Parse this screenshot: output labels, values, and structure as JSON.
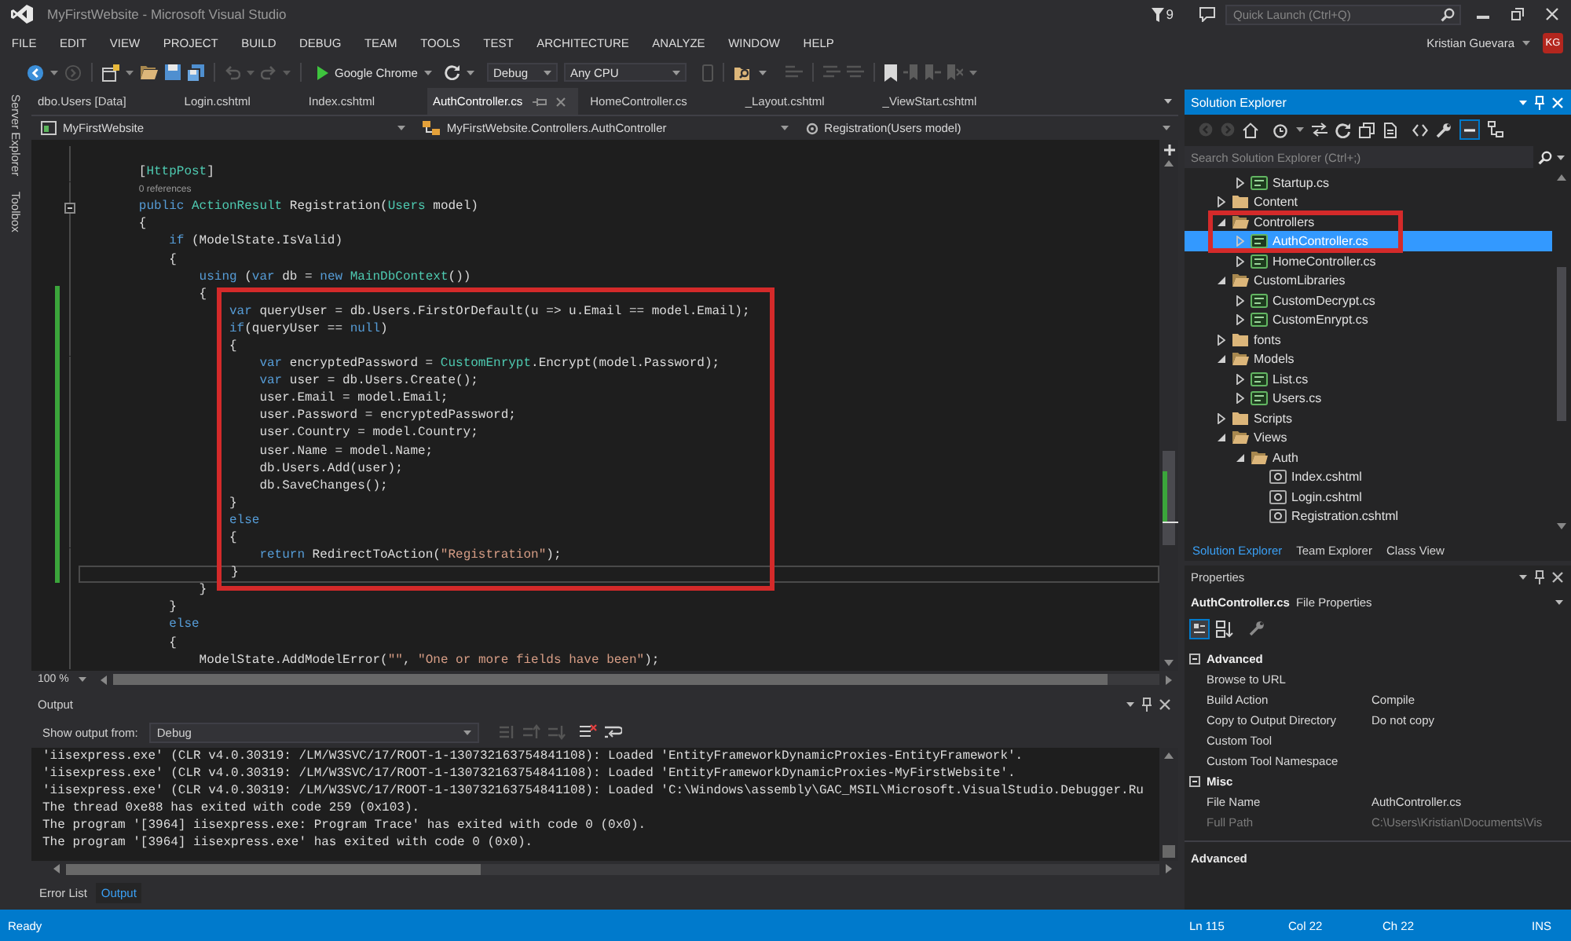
{
  "window": {
    "title": "MyFirstWebsite - Microsoft Visual Studio",
    "notification_count": "9",
    "quick_launch": {
      "placeholder": "Quick Launch (Ctrl+Q)"
    }
  },
  "menu": [
    "FILE",
    "EDIT",
    "VIEW",
    "PROJECT",
    "BUILD",
    "DEBUG",
    "TEAM",
    "TOOLS",
    "TEST",
    "ARCHITECTURE",
    "ANALYZE",
    "WINDOW",
    "HELP"
  ],
  "account": {
    "name": "Kristian Guevara",
    "initials": "KG"
  },
  "toolbar": {
    "run_target": "Google Chrome",
    "configuration": "Debug",
    "platform": "Any CPU"
  },
  "side_tabs": [
    "Server Explorer",
    "Toolbox"
  ],
  "editor": {
    "tabs": [
      {
        "label": "dbo.Users [Data]",
        "selected": false
      },
      {
        "label": "Login.cshtml",
        "selected": false
      },
      {
        "label": "Index.cshtml",
        "selected": false
      },
      {
        "label": "AuthController.cs",
        "selected": true
      },
      {
        "label": "HomeController.cs",
        "selected": false
      },
      {
        "label": "_Layout.cshtml",
        "selected": false
      },
      {
        "label": "_ViewStart.cshtml",
        "selected": false
      }
    ],
    "navigation": {
      "project": "MyFirstWebsite",
      "type": "MyFirstWebsite.Controllers.AuthController",
      "member": "Registration(Users model)"
    },
    "segments": [
      {
        "framed": false,
        "lines": [
          {
            "kind": "blank"
          },
          {
            "kind": "code",
            "changed": false,
            "current": false,
            "tokens": [
              {
                "text": "        [",
                "kind": "plain"
              },
              {
                "text": "HttpPost",
                "kind": "type"
              },
              {
                "text": "]",
                "kind": "plain"
              }
            ]
          },
          {
            "kind": "codelens",
            "changed": false,
            "current": false,
            "text": "        0 references"
          },
          {
            "kind": "declaration",
            "changed": false,
            "current": false,
            "tokens": [
              {
                "text": "        public ",
                "kind": "keyword"
              },
              {
                "text": "ActionResult",
                "kind": "type"
              },
              {
                "text": " Registration(",
                "kind": "plain"
              },
              {
                "text": "Users",
                "kind": "type"
              },
              {
                "text": " model)",
                "kind": "plain"
              }
            ]
          },
          {
            "kind": "code",
            "changed": false,
            "current": false,
            "tokens": [
              {
                "text": "        {",
                "kind": "plain"
              }
            ]
          },
          {
            "kind": "code",
            "changed": false,
            "current": false,
            "tokens": [
              {
                "text": "            if",
                "kind": "keyword"
              },
              {
                "text": " (ModelState.IsValid)",
                "kind": "plain"
              }
            ]
          },
          {
            "kind": "code",
            "changed": false,
            "current": false,
            "tokens": [
              {
                "text": "            {",
                "kind": "plain"
              }
            ]
          },
          {
            "kind": "code",
            "changed": false,
            "current": false,
            "tokens": [
              {
                "text": "                using",
                "kind": "keyword"
              },
              {
                "text": " (",
                "kind": "plain"
              },
              {
                "text": "var",
                "kind": "keyword"
              },
              {
                "text": " db = ",
                "kind": "plain"
              },
              {
                "text": "new ",
                "kind": "keyword"
              },
              {
                "text": "MainDbContext",
                "kind": "type"
              },
              {
                "text": "())",
                "kind": "plain"
              }
            ]
          },
          {
            "kind": "code",
            "changed": true,
            "current": false,
            "tokens": [
              {
                "text": "                {",
                "kind": "plain"
              }
            ]
          }
        ]
      },
      {
        "framed": true,
        "lines": [
          {
            "kind": "code",
            "changed": true,
            "current": false,
            "tokens": [
              {
                "text": "                    var",
                "kind": "keyword"
              },
              {
                "text": " queryUser = db.Users.FirstOrDefault(u => u.Email == model.Email);",
                "kind": "plain"
              }
            ]
          },
          {
            "kind": "code",
            "changed": true,
            "current": false,
            "tokens": [
              {
                "text": "                    if",
                "kind": "keyword"
              },
              {
                "text": "(queryUser == ",
                "kind": "plain"
              },
              {
                "text": "null",
                "kind": "keyword"
              },
              {
                "text": ")",
                "kind": "plain"
              }
            ]
          },
          {
            "kind": "code",
            "changed": true,
            "current": false,
            "tokens": [
              {
                "text": "                    {",
                "kind": "plain"
              }
            ]
          },
          {
            "kind": "code",
            "changed": true,
            "current": false,
            "tokens": [
              {
                "text": "                        var",
                "kind": "keyword"
              },
              {
                "text": " encryptedPassword = ",
                "kind": "plain"
              },
              {
                "text": "CustomEnrypt",
                "kind": "type"
              },
              {
                "text": ".Encrypt(model.Password);",
                "kind": "plain"
              }
            ]
          },
          {
            "kind": "code",
            "changed": true,
            "current": false,
            "tokens": [
              {
                "text": "                        var",
                "kind": "keyword"
              },
              {
                "text": " user = db.Users.Create();",
                "kind": "plain"
              }
            ]
          },
          {
            "kind": "code",
            "changed": true,
            "current": false,
            "tokens": [
              {
                "text": "                        user.Email = model.Email;",
                "kind": "plain"
              }
            ]
          },
          {
            "kind": "code",
            "changed": true,
            "current": false,
            "tokens": [
              {
                "text": "                        user.Password = encryptedPassword;",
                "kind": "plain"
              }
            ]
          },
          {
            "kind": "code",
            "changed": true,
            "current": false,
            "tokens": [
              {
                "text": "                        user.Country = model.Country;",
                "kind": "plain"
              }
            ]
          },
          {
            "kind": "code",
            "changed": true,
            "current": false,
            "tokens": [
              {
                "text": "                        user.Name = model.Name;",
                "kind": "plain"
              }
            ]
          },
          {
            "kind": "code",
            "changed": true,
            "current": false,
            "tokens": [
              {
                "text": "                        db.Users.Add(user);",
                "kind": "plain"
              }
            ]
          },
          {
            "kind": "code",
            "changed": true,
            "current": false,
            "tokens": [
              {
                "text": "                        db.SaveChanges();",
                "kind": "plain"
              }
            ]
          },
          {
            "kind": "code",
            "changed": true,
            "current": false,
            "tokens": [
              {
                "text": "                    }",
                "kind": "plain"
              }
            ]
          },
          {
            "kind": "code",
            "changed": true,
            "current": false,
            "tokens": [
              {
                "text": "                    else",
                "kind": "keyword"
              }
            ]
          },
          {
            "kind": "code",
            "changed": true,
            "current": false,
            "tokens": [
              {
                "text": "                    {",
                "kind": "plain"
              }
            ]
          },
          {
            "kind": "code",
            "changed": true,
            "current": false,
            "tokens": [
              {
                "text": "                        return",
                "kind": "keyword"
              },
              {
                "text": " RedirectToAction(",
                "kind": "plain"
              },
              {
                "text": "\"Registration\"",
                "kind": "string"
              },
              {
                "text": ");",
                "kind": "plain"
              }
            ]
          },
          {
            "kind": "code",
            "changed": true,
            "current": true,
            "tokens": [
              {
                "text": "                    }",
                "kind": "plain"
              }
            ]
          }
        ]
      },
      {
        "framed": false,
        "lines": [
          {
            "kind": "code",
            "changed": false,
            "current": false,
            "tokens": [
              {
                "text": "                }",
                "kind": "plain"
              }
            ]
          },
          {
            "kind": "code",
            "changed": false,
            "current": false,
            "tokens": [
              {
                "text": "            }",
                "kind": "plain"
              }
            ]
          },
          {
            "kind": "code",
            "changed": false,
            "current": false,
            "tokens": [
              {
                "text": "            else",
                "kind": "keyword"
              }
            ]
          },
          {
            "kind": "code",
            "changed": false,
            "current": false,
            "tokens": [
              {
                "text": "            {",
                "kind": "plain"
              }
            ]
          },
          {
            "kind": "code",
            "changed": false,
            "current": false,
            "tokens": [
              {
                "text": "                ModelState.AddModelError(",
                "kind": "plain"
              },
              {
                "text": "\"\"",
                "kind": "string"
              },
              {
                "text": ", ",
                "kind": "plain"
              },
              {
                "text": "\"One or more fields have been\"",
                "kind": "string"
              },
              {
                "text": ");",
                "kind": "plain"
              }
            ]
          }
        ]
      }
    ],
    "zoom": "100 %"
  },
  "output": {
    "title": "Output",
    "source_label": "Show output from:",
    "source": "Debug",
    "lines": [
      "'iisexpress.exe' (CLR v4.0.30319: /LM/W3SVC/17/ROOT-1-130732163754841108): Loaded 'EntityFrameworkDynamicProxies-EntityFramework'.",
      "'iisexpress.exe' (CLR v4.0.30319: /LM/W3SVC/17/ROOT-1-130732163754841108): Loaded 'EntityFrameworkDynamicProxies-MyFirstWebsite'.",
      "'iisexpress.exe' (CLR v4.0.30319: /LM/W3SVC/17/ROOT-1-130732163754841108): Loaded 'C:\\Windows\\assembly\\GAC_MSIL\\Microsoft.VisualStudio.Debugger.Ru",
      "The thread 0xe88 has exited with code 259 (0x103).",
      "The program '[3964] iisexpress.exe: Program Trace' has exited with code 0 (0x0).",
      "The program '[3964] iisexpress.exe' has exited with code 0 (0x0)."
    ],
    "tabs": [
      {
        "label": "Error List",
        "selected": false
      },
      {
        "label": "Output",
        "selected": true
      }
    ]
  },
  "solution_explorer": {
    "title": "Solution Explorer",
    "search": {
      "placeholder": "Search Solution Explorer (Ctrl+;)"
    },
    "tree": [
      {
        "children": [
          {
            "label": "Startup.cs",
            "kind": "csharp",
            "expanded": false,
            "selected": false
          }
        ]
      },
      {
        "label": "Content",
        "kind": "folder",
        "expanded": false,
        "selected": false
      },
      {
        "label": "Controllers",
        "kind": "folder",
        "expanded": true,
        "selected": false,
        "framed": true,
        "children": [
          {
            "label": "AuthController.cs",
            "kind": "csharp",
            "expanded": false,
            "selected": true
          },
          {
            "label": "HomeController.cs",
            "kind": "csharp",
            "expanded": false,
            "selected": false
          }
        ]
      },
      {
        "label": "CustomLibraries",
        "kind": "folder",
        "expanded": true,
        "selected": false,
        "children": [
          {
            "label": "CustomDecrypt.cs",
            "kind": "csharp",
            "expanded": false,
            "selected": false
          },
          {
            "label": "CustomEnrypt.cs",
            "kind": "csharp",
            "expanded": false,
            "selected": false
          }
        ]
      },
      {
        "label": "fonts",
        "kind": "folder",
        "expanded": false,
        "selected": false
      },
      {
        "label": "Models",
        "kind": "folder",
        "expanded": true,
        "selected": false,
        "children": [
          {
            "label": "List.cs",
            "kind": "csharp",
            "expanded": false,
            "selected": false
          },
          {
            "label": "Users.cs",
            "kind": "csharp",
            "expanded": false,
            "selected": false
          }
        ]
      },
      {
        "label": "Scripts",
        "kind": "folder",
        "expanded": false,
        "selected": false
      },
      {
        "label": "Views",
        "kind": "folder",
        "expanded": true,
        "selected": false,
        "children": [
          {
            "label": "Auth",
            "kind": "folder",
            "expanded": true,
            "selected": false,
            "children": [
              {
                "label": "Index.cshtml",
                "kind": "razor",
                "selected": false
              },
              {
                "label": "Login.cshtml",
                "kind": "razor",
                "selected": false
              },
              {
                "label": "Registration.cshtml",
                "kind": "razor",
                "selected": false
              }
            ]
          }
        ]
      }
    ],
    "tabs": [
      {
        "label": "Solution Explorer",
        "selected": true
      },
      {
        "label": "Team Explorer",
        "selected": false
      },
      {
        "label": "Class View",
        "selected": false
      }
    ]
  },
  "properties": {
    "title": "Properties",
    "object": "AuthController.cs",
    "object_type": "File Properties",
    "groups": [
      {
        "name": "Advanced",
        "expanded": true,
        "rows": [
          {
            "name": "Browse to URL",
            "disabled": false
          },
          {
            "name": "Build Action",
            "value": "Compile",
            "disabled": false
          },
          {
            "name": "Copy to Output Directory",
            "value": "Do not copy",
            "disabled": false
          },
          {
            "name": "Custom Tool",
            "disabled": false
          },
          {
            "name": "Custom Tool Namespace",
            "disabled": false
          }
        ]
      },
      {
        "name": "Misc",
        "expanded": true,
        "rows": [
          {
            "name": "File Name",
            "value": "AuthController.cs",
            "disabled": false
          },
          {
            "name": "Full Path",
            "value": "C:\\Users\\Kristian\\Documents\\Vis",
            "disabled": true
          }
        ]
      }
    ],
    "description": "Advanced"
  },
  "status_bar": {
    "message": "Ready",
    "line": "Ln 115",
    "column": "Col 22",
    "character": "Ch 22",
    "mode": "INS"
  }
}
